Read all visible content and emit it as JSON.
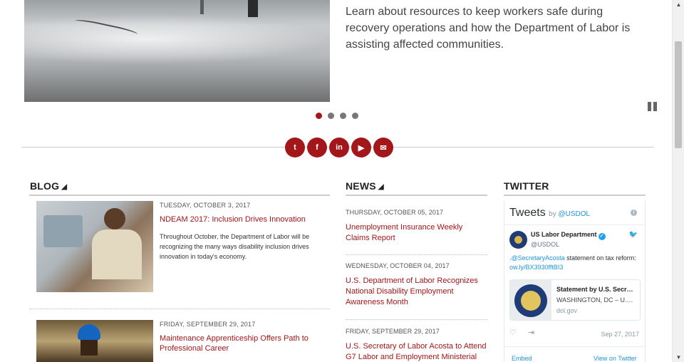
{
  "hero": {
    "description": "Learn about resources to keep workers safe during recovery operations and how the Department of Labor is assisting affected communities."
  },
  "carousel": {
    "slide_count": 4,
    "active_index": 0
  },
  "social_icons": [
    "twitter-icon",
    "facebook-icon",
    "linkedin-icon",
    "youtube-icon",
    "email-icon"
  ],
  "social_glyphs": {
    "twitter": "t",
    "facebook": "f",
    "linkedin": "in",
    "youtube": "▶",
    "email": "✉"
  },
  "blog": {
    "title": "BLOG",
    "posts": [
      {
        "date": "TUESDAY, OCTOBER 3, 2017",
        "title": "NDEAM 2017: Inclusion Drives Innovation",
        "excerpt": "Throughout October, the Department of Labor will be recognizing the many ways disability inclusion drives innovation in today's economy."
      },
      {
        "date": "FRIDAY, SEPTEMBER 29, 2017",
        "title": "Maintenance Apprenticeship Offers Path to Professional Career"
      }
    ]
  },
  "news": {
    "title": "NEWS",
    "items": [
      {
        "date": "THURSDAY, OCTOBER 05, 2017",
        "title": "Unemployment Insurance Weekly Claims Report"
      },
      {
        "date": "WEDNESDAY, OCTOBER 04, 2017",
        "title": "U.S. Department of Labor Recognizes National Disability Employment Awareness Month"
      },
      {
        "date": "FRIDAY, SEPTEMBER 29, 2017",
        "title": "U.S. Secretary of Labor Acosta to Attend G7 Labor and Employment Ministerial"
      }
    ]
  },
  "twitter": {
    "title": "TWITTER",
    "widget_title": "Tweets",
    "by_label": "by",
    "by_handle": "@USDOL",
    "account_name": "US Labor Department",
    "account_handle": "@USDOL",
    "tweet_mention": ".@SecretaryAcosta",
    "tweet_text": " statement on tax reform:",
    "tweet_link": "ow.ly/BX3930fftBI3",
    "card_title": "Statement by U.S. Secr…",
    "card_subtitle": "WASHINGTON, DC – U.…",
    "card_domain": "dol.gov",
    "tweet_date": "Sep 27, 2017",
    "embed_label": "Embed",
    "view_label": "View on Twitter"
  },
  "colors": {
    "accent": "#a3161a",
    "twitter_blue": "#1b95e0"
  }
}
